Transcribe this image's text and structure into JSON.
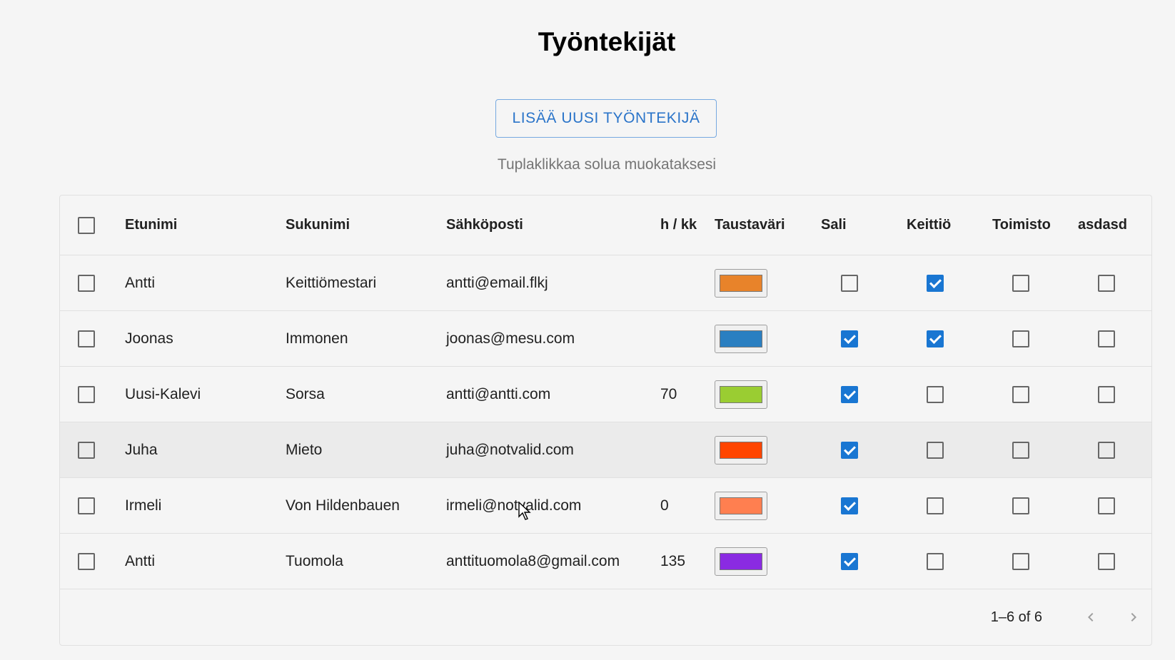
{
  "page": {
    "title": "Työntekijät",
    "add_button_label": "LISÄÄ UUSI TYÖNTEKIJÄ",
    "hint": "Tuplaklikkaa solua muokataksesi"
  },
  "table": {
    "columns": {
      "first_name": "Etunimi",
      "last_name": "Sukunimi",
      "email": "Sähköposti",
      "hours": "h / kk",
      "color": "Taustaväri",
      "sali": "Sali",
      "keittio": "Keittiö",
      "toimisto": "Toimisto",
      "asdasd": "asdasd"
    },
    "rows": [
      {
        "first_name": "Antti",
        "last_name": "Keittiömestari",
        "email": "antti@email.flkj",
        "hours": "",
        "color": "#e8832a",
        "sali": false,
        "keittio": true,
        "toimisto": false,
        "asdasd": false
      },
      {
        "first_name": "Joonas",
        "last_name": "Immonen",
        "email": "joonas@mesu.com",
        "hours": "",
        "color": "#2a7fc1",
        "sali": true,
        "keittio": true,
        "toimisto": false,
        "asdasd": false
      },
      {
        "first_name": "Uusi-Kalevi",
        "last_name": "Sorsa",
        "email": "antti@antti.com",
        "hours": "70",
        "color": "#9acd32",
        "sali": true,
        "keittio": false,
        "toimisto": false,
        "asdasd": false
      },
      {
        "first_name": "Juha",
        "last_name": "Mieto",
        "email": "juha@notvalid.com",
        "hours": "",
        "color": "#ff4500",
        "sali": true,
        "keittio": false,
        "toimisto": false,
        "asdasd": false
      },
      {
        "first_name": "Irmeli",
        "last_name": "Von Hildenbauen",
        "email": "irmeli@notvalid.com",
        "hours": "0",
        "color": "#ff7f50",
        "sali": true,
        "keittio": false,
        "toimisto": false,
        "asdasd": false
      },
      {
        "first_name": "Antti",
        "last_name": "Tuomola",
        "email": "anttituomola8@gmail.com",
        "hours": "135",
        "color": "#8a2be2",
        "sali": true,
        "keittio": false,
        "toimisto": false,
        "asdasd": false
      }
    ],
    "hovered_row": 3
  },
  "pagination": {
    "range_text": "1–6 of 6",
    "prev_icon": "chevron-left-icon",
    "next_icon": "chevron-right-icon"
  },
  "colors": {
    "accent": "#1976d2",
    "button_text": "#2a74c9"
  }
}
